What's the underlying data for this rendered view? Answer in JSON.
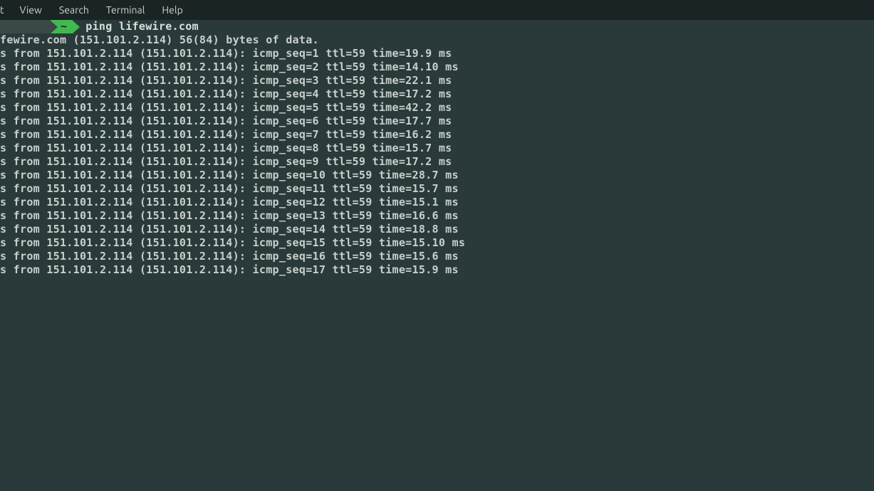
{
  "menubar": {
    "items": [
      "t",
      "View",
      "Search",
      "Terminal",
      "Help"
    ]
  },
  "prompt": {
    "block_text": "",
    "tilde": "~",
    "command": "ping lifewire.com"
  },
  "ping_header": "fewire.com (151.101.2.114) 56(84) bytes of data.",
  "ping_lines": [
    "s from 151.101.2.114 (151.101.2.114): icmp_seq=1 ttl=59 time=19.9 ms",
    "s from 151.101.2.114 (151.101.2.114): icmp_seq=2 ttl=59 time=14.10 ms",
    "s from 151.101.2.114 (151.101.2.114): icmp_seq=3 ttl=59 time=22.1 ms",
    "s from 151.101.2.114 (151.101.2.114): icmp_seq=4 ttl=59 time=17.2 ms",
    "s from 151.101.2.114 (151.101.2.114): icmp_seq=5 ttl=59 time=42.2 ms",
    "s from 151.101.2.114 (151.101.2.114): icmp_seq=6 ttl=59 time=17.7 ms",
    "s from 151.101.2.114 (151.101.2.114): icmp_seq=7 ttl=59 time=16.2 ms",
    "s from 151.101.2.114 (151.101.2.114): icmp_seq=8 ttl=59 time=15.7 ms",
    "s from 151.101.2.114 (151.101.2.114): icmp_seq=9 ttl=59 time=17.2 ms",
    "s from 151.101.2.114 (151.101.2.114): icmp_seq=10 ttl=59 time=28.7 ms",
    "s from 151.101.2.114 (151.101.2.114): icmp_seq=11 ttl=59 time=15.7 ms",
    "s from 151.101.2.114 (151.101.2.114): icmp_seq=12 ttl=59 time=15.1 ms",
    "s from 151.101.2.114 (151.101.2.114): icmp_seq=13 ttl=59 time=16.6 ms",
    "s from 151.101.2.114 (151.101.2.114): icmp_seq=14 ttl=59 time=18.8 ms",
    "s from 151.101.2.114 (151.101.2.114): icmp_seq=15 ttl=59 time=15.10 ms",
    "s from 151.101.2.114 (151.101.2.114): icmp_seq=16 ttl=59 time=15.6 ms",
    "s from 151.101.2.114 (151.101.2.114): icmp_seq=17 ttl=59 time=15.9 ms"
  ]
}
